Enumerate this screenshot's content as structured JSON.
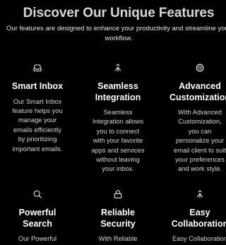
{
  "header": {
    "title": "Discover Our Unique Features",
    "subtitle_lines": [
      "Our features are designed to enhance your productivity and streamline your",
      "workflow."
    ]
  },
  "features": [
    {
      "icon": "inbox-icon",
      "title_lines": [
        "Smart Inbox"
      ],
      "desc_lines": [
        "Our Smart Inbox",
        "feature helps you",
        "manage your",
        "emails efficiently",
        "by prioritizing",
        "important emails."
      ]
    },
    {
      "icon": "integration-icon",
      "title_lines": [
        "Seamless",
        "Integration"
      ],
      "desc_lines": [
        "Seamless",
        "Integration allows",
        "you to connect",
        "with your favorite",
        "apps and services",
        "without leaving",
        "your inbox."
      ]
    },
    {
      "icon": "gear-icon",
      "title_lines": [
        "Advanced",
        "Customization"
      ],
      "desc_lines": [
        "With Advanced",
        "Customization,",
        "you can",
        "personalize your",
        "email client to suit",
        "your preferences",
        "and work style."
      ]
    },
    {
      "icon": "search-icon",
      "title_lines": [
        "Powerful",
        "Search"
      ],
      "desc_lines": [
        "Our Powerful"
      ]
    },
    {
      "icon": "lock-icon",
      "title_lines": [
        "Reliable",
        "Security"
      ],
      "desc_lines": [
        "With Reliable"
      ]
    },
    {
      "icon": "collaboration-icon",
      "title_lines": [
        "Easy",
        "Collaboration"
      ],
      "desc_lines": [
        "Easy Collaboration"
      ]
    }
  ]
}
